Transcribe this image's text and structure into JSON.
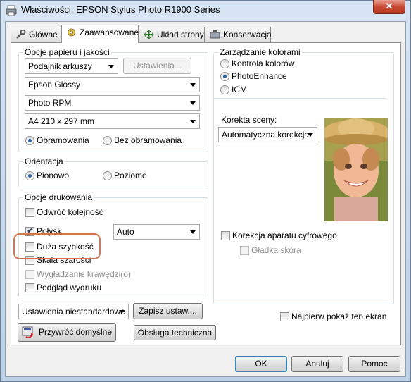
{
  "window": {
    "title": "Właściwości: EPSON Stylus Photo R1900 Series",
    "close_glyph": "✕"
  },
  "tabs": [
    {
      "label": "Główne"
    },
    {
      "label": "Zaawansowane"
    },
    {
      "label": "Układ strony"
    },
    {
      "label": "Konserwacja"
    }
  ],
  "paper": {
    "group_label": "Opcje papieru i jakości",
    "source_value": "Podajnik arkuszy",
    "settings_button": "Ustawienia...",
    "media_value": "Epson Glossy",
    "quality_value": "Photo RPM",
    "size_value": "A4 210 x 297 mm",
    "border_label": "Obramowania",
    "borderless_label": "Bez obramowania"
  },
  "orientation": {
    "group_label": "Orientacja",
    "portrait_label": "Pionowo",
    "landscape_label": "Poziomo"
  },
  "print_options": {
    "group_label": "Opcje drukowania",
    "reverse_order": "Odwróć kolejność",
    "bidirectional": "Połysk",
    "bidirectional_value": "Auto",
    "high_speed": "Duża szybkość",
    "grayscale": "Skala szarości",
    "smoothing": "Wygładzanie krawędzi(o)",
    "preview": "Podgląd wydruku"
  },
  "color": {
    "group_label": "Zarządzanie kolorami",
    "color_controls": "Kontrola kolorów",
    "photo_enhance": "PhotoEnhance",
    "icm": "ICM",
    "scene_label": "Korekta sceny:",
    "scene_value": "Automatyczna korekcja",
    "digital_camera": "Korekcja aparatu cyfrowego",
    "smooth_skin": "Gładka skóra"
  },
  "footer": {
    "custom_value": "Ustawienia niestandardowe",
    "save_button": "Zapisz ustaw....",
    "restore_button": "Przywróć domyślne",
    "support_button": "Obsługa techniczna",
    "show_first": "Najpierw pokaż ten ekran",
    "ok_button": "OK",
    "cancel_button": "Anuluj",
    "help_button": "Pomoc"
  },
  "colors": {
    "highlight": "#d9734a",
    "accent": "#2a5fa8"
  }
}
